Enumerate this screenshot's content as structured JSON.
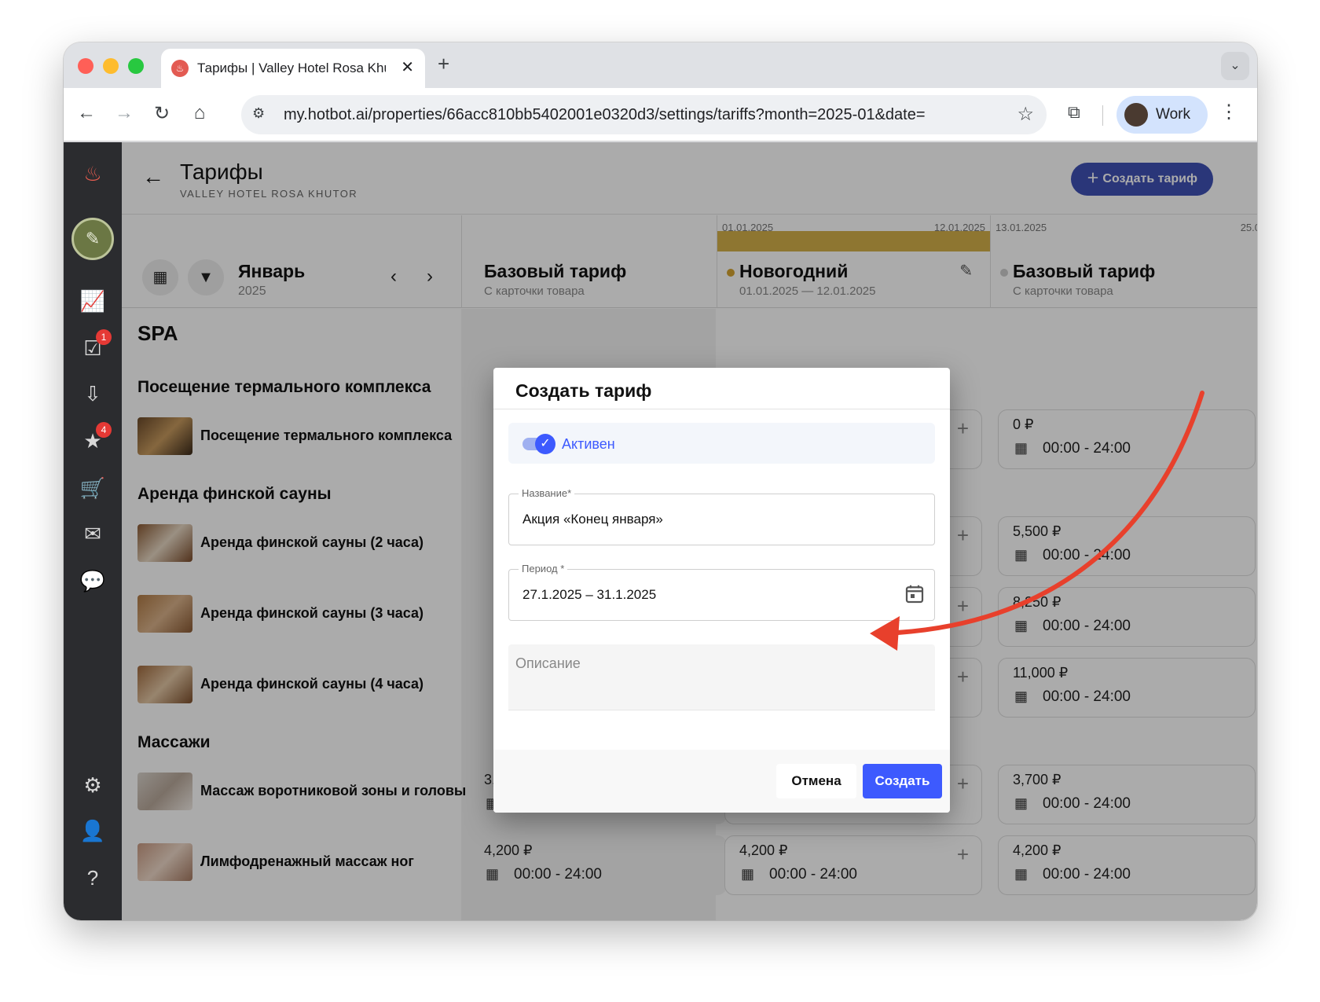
{
  "browser": {
    "tab_title": "Тарифы | Valley Hotel Rosa Khutor",
    "url": "my.hotbot.ai/properties/66acc810bb5402001e0320d3/settings/tariffs?month=2025-01&date=",
    "profile_name": "Work"
  },
  "sidebar": {
    "badges": {
      "tasks": "1",
      "reviews": "4"
    }
  },
  "header": {
    "title": "Тарифы",
    "subtitle": "VALLEY HOTEL ROSA KHUTOR",
    "create_button": "Создать тариф"
  },
  "calendar": {
    "month": "Январь",
    "year": "2025"
  },
  "columns": [
    {
      "name": "Базовый тариф",
      "sub": "С карточки товара"
    },
    {
      "name": "Новогодний",
      "sub": "01.01.2025 — 12.01.2025",
      "date_start": "01.01.2025",
      "date_end": "12.01.2025"
    },
    {
      "name": "Базовый тариф",
      "sub": "С карточки товара",
      "date_start": "13.01.2025",
      "date_end": "25.0"
    }
  ],
  "sections": {
    "spa": "SPA",
    "thermal": "Посещение термального комплекса",
    "sauna": "Аренда финской сауны",
    "massage": "Массажи"
  },
  "services": {
    "thermal_visit": "Посещение термального комплекса",
    "sauna_2": "Аренда финской сауны (2 часа)",
    "sauna_3": "Аренда финской сауны (3 часа)",
    "sauna_4": "Аренда финской сауны (4 часа)",
    "massage_neck": "Массаж воротниковой зоны и головы",
    "massage_legs": "Лимфодренажный массаж ног"
  },
  "cells": {
    "time": "00:00 - 24:00",
    "c0": "00",
    "p_thermal": "0 ₽",
    "p_sauna2": "5,500 ₽",
    "p_sauna3": "8,250 ₽",
    "p_sauna4": "11,000 ₽",
    "p_neck": "3,700 ₽",
    "p_legs": "4,200 ₽"
  },
  "dialog": {
    "title": "Создать тариф",
    "active_label": "Активен",
    "name_label": "Название*",
    "name_value": "Акция «Конец января»",
    "period_label": "Период *",
    "period_value": "27.1.2025 – 31.1.2025",
    "description_placeholder": "Описание",
    "cancel": "Отмена",
    "submit": "Создать"
  },
  "colors": {
    "accent": "#3d5afe",
    "header_button": "#3f51b5",
    "annotation_arrow": "#e8402c",
    "new_year_bar": "#d4b14a"
  }
}
